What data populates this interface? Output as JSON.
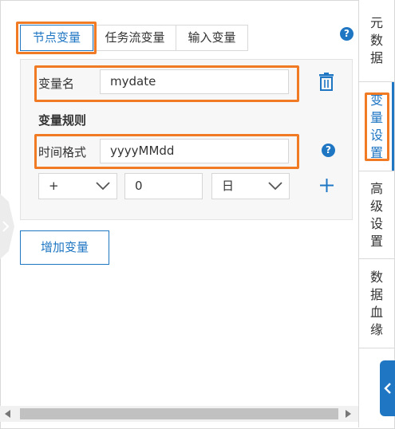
{
  "tabs": [
    {
      "label": "节点变量",
      "active": true
    },
    {
      "label": "任务流变量",
      "active": false
    },
    {
      "label": "输入变量",
      "active": false
    }
  ],
  "variable": {
    "name_label": "变量名",
    "name_value": "mydate",
    "rule_title": "变量规则",
    "format_label": "时间格式",
    "format_value": "yyyyMMdd",
    "operator": "+",
    "offset": "0",
    "unit": "日"
  },
  "add_button": "增加变量",
  "sidebar": [
    {
      "label": "元数据",
      "active": false
    },
    {
      "label": "变量设置",
      "active": true
    },
    {
      "label": "高级设置",
      "active": false
    },
    {
      "label": "数据血缘",
      "active": false
    }
  ],
  "icons": {
    "help": "help-icon",
    "delete": "trash-icon",
    "add_rule": "plus-icon",
    "collapse": "chevron-left-icon",
    "expand": "chevron-right-icon"
  },
  "colors": {
    "accent": "#1f76c3",
    "highlight": "#f07b24"
  }
}
